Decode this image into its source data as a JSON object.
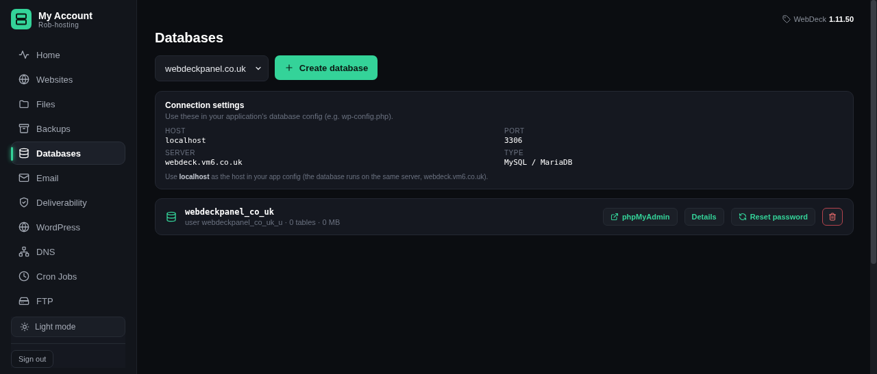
{
  "account": {
    "title": "My Account",
    "subtitle": "Rob-hosting"
  },
  "nav": [
    {
      "label": "Home",
      "selected": false
    },
    {
      "label": "Websites",
      "selected": false
    },
    {
      "label": "Files",
      "selected": false
    },
    {
      "label": "Backups",
      "selected": false
    },
    {
      "label": "Databases",
      "selected": true
    },
    {
      "label": "Email",
      "selected": false
    },
    {
      "label": "Deliverability",
      "selected": false
    },
    {
      "label": "WordPress",
      "selected": false
    },
    {
      "label": "DNS",
      "selected": false
    },
    {
      "label": "Cron Jobs",
      "selected": false
    },
    {
      "label": "FTP",
      "selected": false
    }
  ],
  "theme_button": "Light mode",
  "sign_out": "Sign out",
  "version": {
    "name": "WebDeck",
    "number": "1.11.50"
  },
  "page_title": "Databases",
  "domain_select": {
    "value": "webdeckpanel.co.uk"
  },
  "create_button": "Create database",
  "connection": {
    "title": "Connection settings",
    "subtitle": "Use these in your application's database config (e.g. wp-config.php).",
    "fields": [
      {
        "label": "HOST",
        "value": "localhost"
      },
      {
        "label": "PORT",
        "value": "3306"
      },
      {
        "label": "SERVER",
        "value": "webdeck.vm6.co.uk"
      },
      {
        "label": "TYPE",
        "value": "MySQL / MariaDB"
      }
    ],
    "note": "Use **localhost** as the host in your app config (the database runs on the same server, webdeck.vm6.co.uk)."
  },
  "databases": [
    {
      "name": "webdeckpanel_co_uk",
      "meta": "user webdeckpanel_co_uk_u · 0 tables · 0 MB",
      "actions": [
        "phpMyAdmin",
        "Details",
        "Reset password"
      ]
    }
  ]
}
